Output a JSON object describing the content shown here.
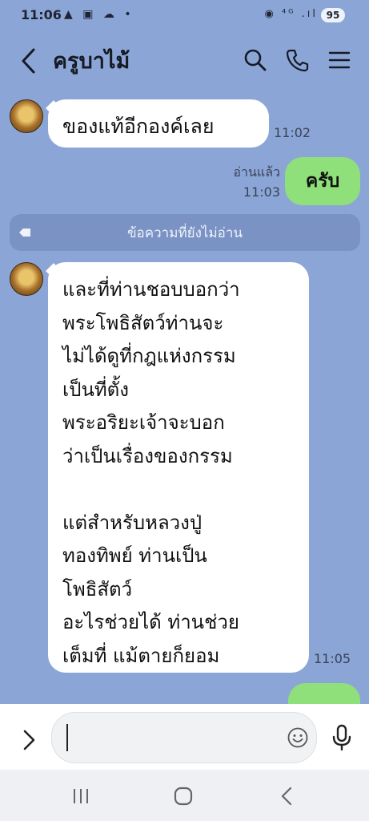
{
  "status_bar": {
    "time": "11:06",
    "left_icons": "▲ ▣ ☁ •",
    "right_icons": "◉ ⁴ᴳ .ıl",
    "battery": "95"
  },
  "header": {
    "title": "ครูบาไม้",
    "icons": [
      "back-icon",
      "search-icon",
      "phone-icon",
      "menu-icon"
    ]
  },
  "messages": {
    "m1": {
      "text": "ของแท้อีกองค์เลย",
      "time": "11:02"
    },
    "m2": {
      "text": "ครับ",
      "read": "อ่านแล้ว",
      "time": "11:03"
    },
    "unread_divider": "ข้อความที่ยังไม่อ่าน",
    "m3": {
      "lines": [
        "และที่ท่านชอบบอกว่า",
        "พระโพธิสัตว์ท่านจะ",
        "ไม่ได้ดูที่กฎแห่งกรรม",
        "เป็นที่ตั้ง",
        "พระอริยะเจ้าจะบอก",
        "ว่าเป็นเรื่องของกรรม",
        "",
        "แต่สำหรับหลวงปู่",
        "ทองทิพย์ ท่านเป็น",
        "โพธิสัตว์",
        "อะไรช่วยได้ ท่านช่วย",
        "เต็มที่ แม้ตายก็ยอม"
      ],
      "time": "11:05"
    }
  },
  "colors": {
    "chat_bg": "#8ba6d6",
    "incoming_bubble": "#ffffff",
    "outgoing_bubble": "#8fe07a",
    "unread_bar": "#7b93c4"
  }
}
